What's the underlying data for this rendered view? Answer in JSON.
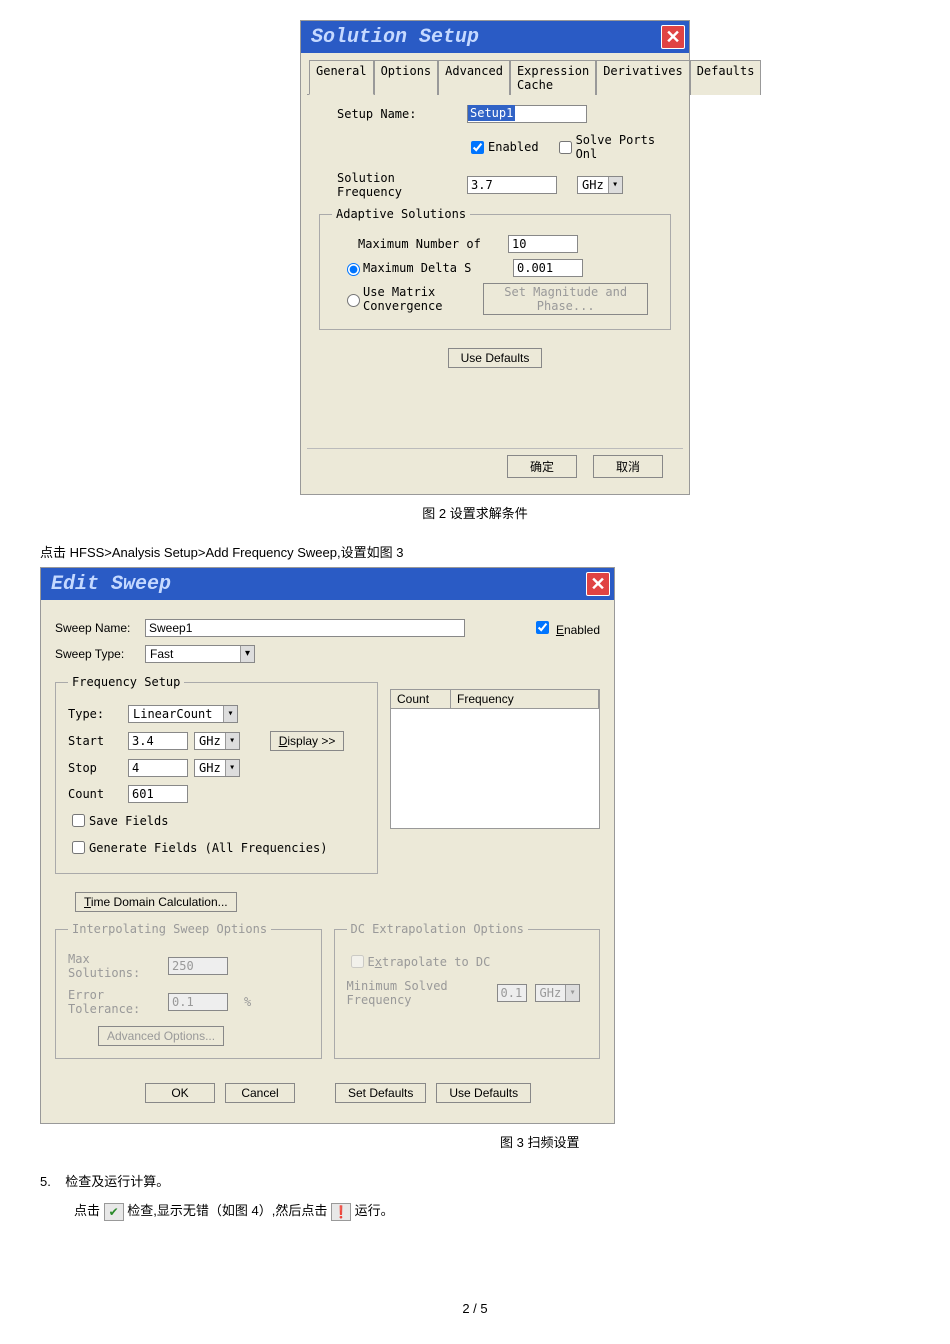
{
  "dialog1": {
    "title": "Solution Setup",
    "tabs": [
      "General",
      "Options",
      "Advanced",
      "Expression Cache",
      "Derivatives",
      "Defaults"
    ],
    "setup_name_label": "Setup Name:",
    "setup_name_value": "Setup1",
    "enabled_label": "Enabled",
    "solve_ports_label": "Solve Ports Onl",
    "solution_freq_label": "Solution Frequency",
    "solution_freq_value": "3.7",
    "solution_freq_unit": "GHz",
    "adaptive_legend": "Adaptive Solutions",
    "max_num_label": "Maximum Number of",
    "max_num_value": "10",
    "max_delta_label": "Maximum Delta S",
    "max_delta_value": "0.001",
    "matrix_conv_label": "Use Matrix Convergence",
    "set_mag_btn": "Set Magnitude and Phase...",
    "use_defaults_btn": "Use Defaults",
    "ok_btn": "确定",
    "cancel_btn": "取消"
  },
  "caption1": "图 2 设置求解条件",
  "note_line": "点击 HFSS>Analysis Setup>Add Frequency Sweep,设置如图 3",
  "dialog2": {
    "title": "Edit Sweep",
    "sweep_name_label": "Sweep Name:",
    "sweep_name_value": "Sweep1",
    "enabled_label": "Enabled",
    "sweep_type_label": "Sweep Type:",
    "sweep_type_value": "Fast",
    "freq_setup_legend": "Frequency Setup",
    "type_label": "Type:",
    "type_value": "LinearCount",
    "start_label": "Start",
    "start_value": "3.4",
    "start_unit": "GHz",
    "stop_label": "Stop",
    "stop_value": "4",
    "stop_unit": "GHz",
    "count_label": "Count",
    "count_value": "601",
    "display_btn": "Display >>",
    "list_headers": [
      "Count",
      "Frequency"
    ],
    "save_fields_label": "Save Fields",
    "gen_fields_label": "Generate Fields (All Frequencies)",
    "time_domain_btn": "Time Domain Calculation...",
    "interp_legend": "Interpolating Sweep Options",
    "max_sol_label": "Max Solutions:",
    "max_sol_value": "250",
    "err_tol_label": "Error Tolerance:",
    "err_tol_value": "0.1",
    "err_tol_unit": "%",
    "adv_opts_btn": "Advanced Options...",
    "dc_legend": "DC Extrapolation Options",
    "extrap_label": "Extrapolate to DC",
    "min_freq_label": "Minimum Solved Frequency",
    "min_freq_value": "0.1",
    "min_freq_unit": "GHz",
    "ok_btn": "OK",
    "cancel_btn": "Cancel",
    "set_defaults_btn": "Set Defaults",
    "use_defaults_btn": "Use Defaults"
  },
  "caption2": "图 3 扫频设置",
  "step5": {
    "num": "5.",
    "title": "检查及运行计算。",
    "line_part1": "点击",
    "line_part2": "检查,显示无错（如图 4）,然后点击",
    "line_part3": "运行。",
    "icon1": "✔",
    "icon2": "❗"
  },
  "page_footer": "2 / 5"
}
